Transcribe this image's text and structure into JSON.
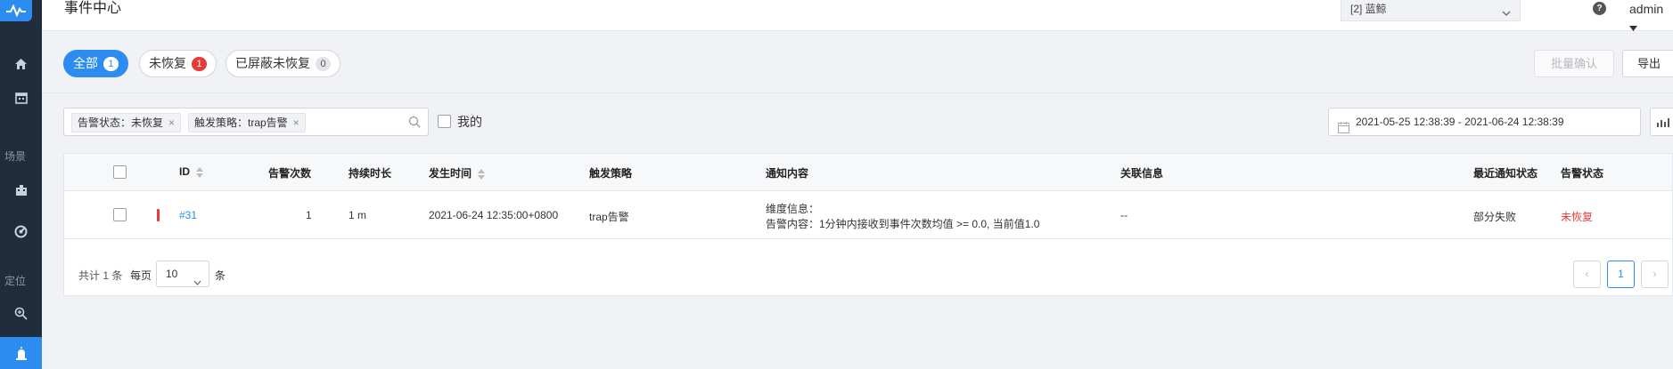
{
  "header": {
    "title": "事件中心",
    "tenant_select": "[2] 蓝鲸",
    "help_icon": "?",
    "user": "admin"
  },
  "sidebar": {
    "section_scene": "场景",
    "section_locate": "定位"
  },
  "tabs": [
    {
      "label": "全部",
      "count": "1"
    },
    {
      "label": "未恢复",
      "count": "1"
    },
    {
      "label": "已屏蔽未恢复",
      "count": "0"
    }
  ],
  "actions": {
    "batch_confirm": "批量确认",
    "export": "导出"
  },
  "filters": {
    "tag_status": "告警状态：未恢复",
    "tag_strategy": "触发策略：trap告警",
    "tag_close": "×",
    "mine_label": "我的",
    "date_range": "2021-05-25 12:38:39 - 2021-06-24 12:38:39"
  },
  "table": {
    "columns": [
      "ID",
      "告警次数",
      "持续时长",
      "发生时间",
      "触发策略",
      "通知内容",
      "关联信息",
      "最近通知状态",
      "告警状态"
    ],
    "rows": [
      {
        "id": "#31",
        "alert_count": "1",
        "duration": "1 m",
        "time": "2021-06-24 12:35:00+0800",
        "strategy": "trap告警",
        "notice_line1": "维度信息：",
        "notice_line2": "告警内容：1分钟内接收到事件次数均值 >= 0.0, 当前值1.0",
        "related": "--",
        "notify_status": "部分失败",
        "alert_status": "未恢复"
      }
    ]
  },
  "footer": {
    "total": "共计 1 条",
    "per_page_label": "每页",
    "page_size": "10",
    "per_page_unit": "条",
    "prev": "‹",
    "current_page": "1",
    "next": "›"
  },
  "colors": {
    "accent": "#2d8cf0",
    "danger": "#e93a3a",
    "sidebar": "#1f2d3d"
  }
}
